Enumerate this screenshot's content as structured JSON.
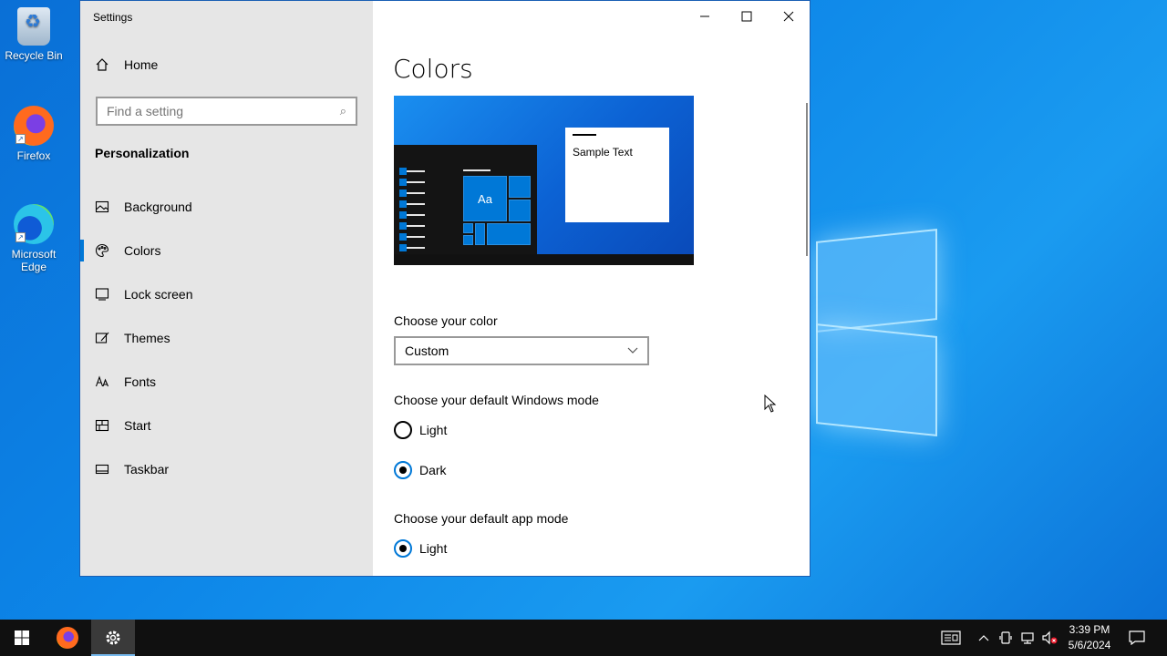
{
  "desktop": {
    "icons": [
      {
        "label": "Recycle Bin"
      },
      {
        "label": "Firefox"
      },
      {
        "label": "Microsoft Edge"
      }
    ]
  },
  "window": {
    "title": "Settings",
    "caption_buttons": [
      "minimize-icon",
      "maximize-icon",
      "close-icon"
    ]
  },
  "sidebar": {
    "home_label": "Home",
    "search_placeholder": "Find a setting",
    "section_title": "Personalization",
    "items": [
      {
        "label": "Background",
        "icon": "picture-icon"
      },
      {
        "label": "Colors",
        "icon": "palette-icon",
        "active": true
      },
      {
        "label": "Lock screen",
        "icon": "lock-screen-icon"
      },
      {
        "label": "Themes",
        "icon": "brush-icon"
      },
      {
        "label": "Fonts",
        "icon": "font-icon"
      },
      {
        "label": "Start",
        "icon": "start-icon"
      },
      {
        "label": "Taskbar",
        "icon": "taskbar-icon"
      }
    ]
  },
  "main": {
    "title": "Colors",
    "preview": {
      "tile_label": "Aa",
      "sample_text": "Sample Text"
    },
    "choose_color": {
      "label": "Choose your color",
      "value": "Custom"
    },
    "windows_mode": {
      "label": "Choose your default Windows mode",
      "options": [
        "Light",
        "Dark"
      ],
      "selected": "Dark"
    },
    "app_mode": {
      "label": "Choose your default app mode",
      "options": [
        "Light"
      ],
      "selected": "Light"
    }
  },
  "taskbar": {
    "clock_time": "3:39 PM",
    "clock_date": "5/6/2024"
  },
  "colors": {
    "accent": "#0078d7",
    "desktop": "#0d86e8",
    "sidebar_bg": "#e6e6e6",
    "taskbar_bg": "#101010"
  }
}
